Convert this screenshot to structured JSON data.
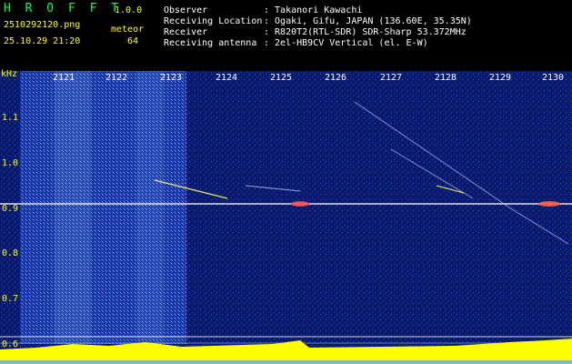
{
  "header": {
    "title": "H R O F F T",
    "version": "1.0.0",
    "filename": "2510292120.png",
    "timestamp": "25.10.29 21:20",
    "mode_label": "meteor",
    "count": "64",
    "observer_label": "Observer",
    "observer_value": ": Takanori Kawachi",
    "location_label": "Receiving Location",
    "location_value": ": Ogaki, Gifu, JAPAN (136.60E, 35.35N)",
    "receiver_label": "Receiver",
    "receiver_value": ": R820T2(RTL-SDR) SDR-Sharp 53.372MHz",
    "antenna_label": "Receiving antenna",
    "antenna_value": ": 2el-HB9CV Vertical (el. E-W)"
  },
  "axis": {
    "unit": "kHz",
    "y_ticks": [
      "1.1",
      "1.0",
      "0.9",
      "0.8",
      "0.7",
      "0.6"
    ],
    "x_ticks": [
      "2121",
      "2122",
      "2123",
      "2124",
      "2125",
      "2126",
      "2127",
      "2128",
      "2129",
      "2130"
    ]
  },
  "colors": {
    "background": "#0a1a6b",
    "signal": "#ffffff",
    "accent": "#ffff00",
    "title": "#00ff66"
  }
}
